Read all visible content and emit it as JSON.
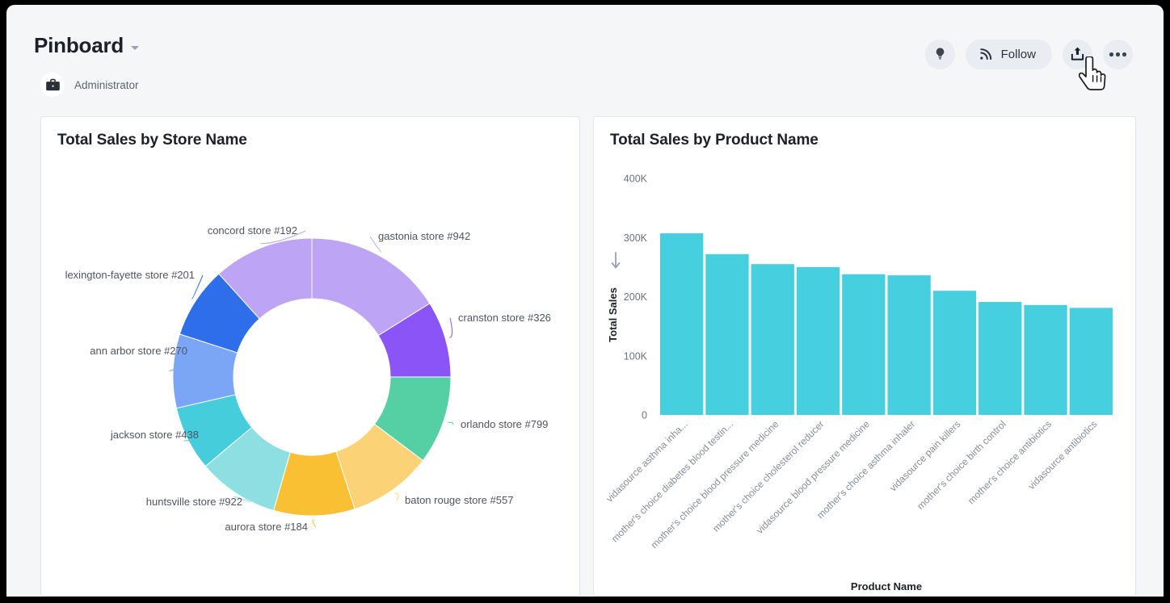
{
  "header": {
    "title": "Pinboard",
    "owner": "Administrator",
    "owner_icon": "briefcase-icon",
    "caret_icon": "chevron-down-icon",
    "lightbulb_icon": "lightbulb-icon",
    "follow_label": "Follow",
    "follow_icon": "rss-icon",
    "share_icon": "share-upload-icon",
    "more_icon": "ellipsis-icon",
    "cursor_icon": "pointing-hand-cursor"
  },
  "cards": {
    "left_title": "Total Sales by Store Name",
    "right_title": "Total Sales by Product Name"
  },
  "chart_data": [
    {
      "type": "pie",
      "title": "Total Sales by Store Name",
      "variant": "donut",
      "legend": "labels-with-leader-lines",
      "labels": [
        "gastonia store #942",
        "cranston store #326",
        "orlando store #799",
        "baton rouge store #557",
        "aurora store #184",
        "huntsville store #922",
        "jackson store #438",
        "ann arbor store #270",
        "lexington-fayette store #201",
        "concord store #192"
      ],
      "values": [
        16.1,
        10.6,
        10.3,
        9.7,
        9.4,
        9.4,
        7.5,
        8.6,
        8.3,
        10.1
      ],
      "colors": [
        "#bda4f5",
        "#8b54f7",
        "#55cfa4",
        "#fcd277",
        "#f9c034",
        "#8ddfe2",
        "#45cddc",
        "#7ba6f5",
        "#2f6eea",
        "#bda4f5"
      ],
      "angles_deg": [
        [
          0,
          58
        ],
        [
          58,
          90
        ],
        [
          90,
          127
        ],
        [
          127,
          162
        ],
        [
          162,
          196
        ],
        [
          196,
          230
        ],
        [
          230,
          257
        ],
        [
          257,
          288
        ],
        [
          288,
          318
        ],
        [
          318,
          360
        ]
      ]
    },
    {
      "type": "bar",
      "title": "Total Sales by Product Name",
      "xlabel": "Product Name",
      "ylabel": "Total Sales",
      "sort_indicator": "descending-arrow",
      "ylim": [
        0,
        400000
      ],
      "yticks": [
        0,
        100000,
        200000,
        300000,
        400000
      ],
      "ytick_labels": [
        "0",
        "100K",
        "200K",
        "300K",
        "400K"
      ],
      "bar_color": "#45cfdf",
      "categories": [
        "vidasource asthma inha...",
        "mother's choice diabetes blood testin...",
        "mother's choice blood pressure medicine",
        "mother's choice cholesterol reducer",
        "vidasource blood pressure medicine",
        "mother's choice asthma inhaler",
        "vidasource pain killers",
        "mother's choice birth control",
        "mother's choice antibiotics",
        "vidasource antibiotics"
      ],
      "values": [
        307000,
        272000,
        255000,
        250000,
        238000,
        236000,
        210000,
        191000,
        186000,
        181000
      ]
    }
  ]
}
